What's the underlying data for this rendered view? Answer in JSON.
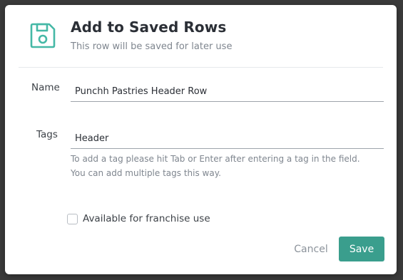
{
  "colors": {
    "accent": "#3a9e8d",
    "icon": "#45b8a6",
    "backdrop": "#3a3a3a"
  },
  "dialog": {
    "icon": "floppy-disk-icon",
    "title": "Add to Saved Rows",
    "subtitle": "This row will be saved for later use"
  },
  "form": {
    "name": {
      "label": "Name",
      "value": "Punchh Pastries Header Row"
    },
    "tags": {
      "label": "Tags",
      "value": "Header",
      "help": [
        "To add a tag please hit Tab or Enter after entering a tag in the field.",
        "You can add multiple tags this way."
      ]
    },
    "franchise": {
      "label": "Available for franchise use",
      "checked": false
    }
  },
  "actions": {
    "cancel_label": "Cancel",
    "save_label": "Save"
  }
}
